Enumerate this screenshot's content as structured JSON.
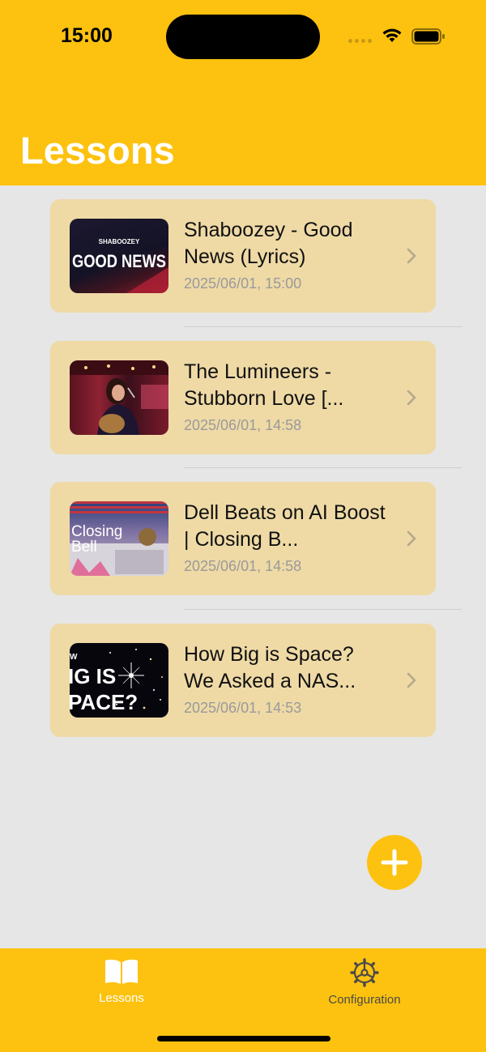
{
  "status_bar": {
    "time": "15:00"
  },
  "header": {
    "title": "Lessons"
  },
  "lessons": [
    {
      "title": "Shaboozey - Good News (Lyrics)",
      "date": "2025/06/01, 15:00",
      "thumb_top": "SHABOOZEY",
      "thumb_main": "GOOD NEWS"
    },
    {
      "title": "The Lumineers - Stubborn Love [...",
      "date": "2025/06/01, 14:58"
    },
    {
      "title": "Dell Beats on AI Boost | Closing B...",
      "date": "2025/06/01, 14:58",
      "thumb_line1": "Closing",
      "thumb_line2": "Bell"
    },
    {
      "title": "How Big is Space? We Asked a NAS...",
      "date": "2025/06/01, 14:53",
      "thumb_line1": "W",
      "thumb_line2": "IG IS",
      "thumb_line3": "PACE?"
    }
  ],
  "fab": {
    "icon": "plus-icon"
  },
  "tabbar": {
    "tabs": [
      {
        "label": "Lessons",
        "icon": "book-icon",
        "active": true
      },
      {
        "label": "Configuration",
        "icon": "gear-icon",
        "active": false
      }
    ]
  },
  "colors": {
    "accent": "#fdc20f",
    "card": "#efdaa6",
    "background": "#e6e6e6",
    "active_tab": "#ffffff",
    "inactive_tab": "#4a4a4a"
  }
}
